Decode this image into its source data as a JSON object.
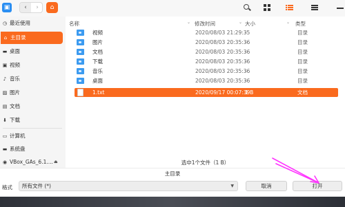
{
  "toolbar": {
    "app_icon": "file-manager-icon",
    "back_icon": "chevron-left-icon",
    "forward_icon": "chevron-right-icon",
    "home_icon": "home-icon",
    "back_glyph": "‹",
    "forward_glyph": "›",
    "home_glyph": "⌂",
    "accent": "#fa6a1e"
  },
  "sidebar": {
    "items": [
      {
        "label": "最近使用",
        "icon": "clock-icon",
        "glyph": "◷"
      },
      {
        "label": "主目录",
        "icon": "home-icon",
        "glyph": "⌂",
        "active": true
      },
      {
        "label": "桌面",
        "icon": "desktop-icon",
        "glyph": "▬"
      },
      {
        "label": "视频",
        "icon": "video-icon",
        "glyph": "▣"
      },
      {
        "label": "音乐",
        "icon": "music-icon",
        "glyph": "♪"
      },
      {
        "label": "图片",
        "icon": "picture-icon",
        "glyph": "▨"
      },
      {
        "label": "文档",
        "icon": "document-icon",
        "glyph": "▤"
      },
      {
        "label": "下载",
        "icon": "download-icon",
        "glyph": "⬇"
      },
      {
        "label": "计算机",
        "icon": "computer-icon",
        "glyph": "▭"
      },
      {
        "label": "系统盘",
        "icon": "disk-icon",
        "glyph": "▬"
      },
      {
        "label": "VBox_GAs_6.1....",
        "icon": "cdrom-icon",
        "glyph": "◉"
      }
    ],
    "eject_glyph": "⏏"
  },
  "columns": {
    "name": "名称",
    "modified": "修改时间",
    "size": "大小",
    "type": "类型"
  },
  "files": [
    {
      "name": "视频",
      "modified": "2020/08/03 21:29:35",
      "size": "-",
      "type": "目录",
      "icon": "folder-icon"
    },
    {
      "name": "图片",
      "modified": "2020/08/03 20:35:36",
      "size": "-",
      "type": "目录",
      "icon": "folder-icon"
    },
    {
      "name": "文档",
      "modified": "2020/08/03 20:35:36",
      "size": "-",
      "type": "目录",
      "icon": "folder-icon"
    },
    {
      "name": "下载",
      "modified": "2020/08/03 20:35:36",
      "size": "-",
      "type": "目录",
      "icon": "folder-icon"
    },
    {
      "name": "音乐",
      "modified": "2020/08/03 20:35:36",
      "size": "-",
      "type": "目录",
      "icon": "folder-icon"
    },
    {
      "name": "桌面",
      "modified": "2020/08/03 20:35:36",
      "size": "-",
      "type": "目录",
      "icon": "folder-icon"
    },
    {
      "name": "1.txt",
      "modified": "2020/09/17 00:07:39",
      "size": "1 B",
      "type": "文档",
      "icon": "text-file-icon",
      "selected": true
    }
  ],
  "status": "选中1个文件（1 B）",
  "current_dir": "主目录",
  "filter": {
    "label": "格式",
    "value": "所有文件 (*)"
  },
  "buttons": {
    "cancel": "取消",
    "save": "打开"
  },
  "annotation_color": "#ff33ff"
}
